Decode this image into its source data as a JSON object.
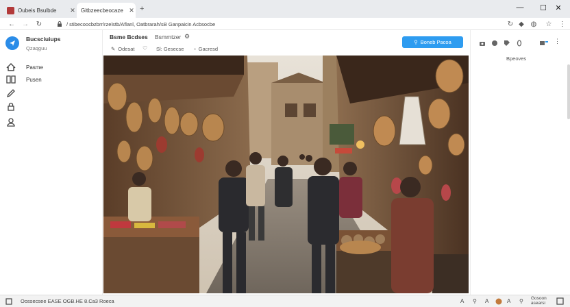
{
  "browser": {
    "tabs": [
      {
        "title": "Oubeis Bsulbde",
        "active": false
      },
      {
        "title": "Gitbzeecbeocaze",
        "active": true
      }
    ],
    "new_tab": "+",
    "url": "/ stibecoocbzbrr/rzelstb/Aflanl, Oatbrarah/sB Ganpaicin Acbsocbe"
  },
  "sidebar": {
    "app_name": "Bucsciuiups",
    "app_sub": "Qzaqguu",
    "items": [
      {
        "label": "Pasme"
      },
      {
        "label": "Pusen"
      }
    ]
  },
  "header": {
    "title": "Bsme Bcdses",
    "subtitle": "Bsmmtzer",
    "tool1": "Odesat",
    "tool2": "Sl: Gesecse",
    "tool3": "Gacresd",
    "primary_button": "Boneb Pacoa"
  },
  "rightpanel": {
    "label": "Bpeoves"
  },
  "statusbar": {
    "left": "Oossecsee EASE OGB.HE 8.Ca3 Roeca",
    "right": "Gosoon\nasearsi"
  },
  "colors": {
    "accent": "#2e9cf0",
    "logo": "#2a8ce8"
  }
}
